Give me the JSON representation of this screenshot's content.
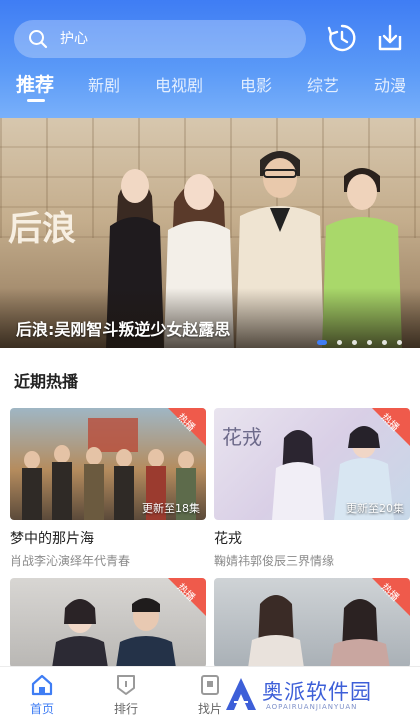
{
  "header": {
    "search_placeholder": "护心",
    "colors": {
      "accent": "#3f7df4",
      "header_top": "#3f7df4",
      "header_bottom": "#79b0fa"
    }
  },
  "tabs": [
    {
      "label": "推荐",
      "active": true
    },
    {
      "label": "新剧",
      "active": false
    },
    {
      "label": "电视剧",
      "active": false
    },
    {
      "label": "电影",
      "active": false
    },
    {
      "label": "综艺",
      "active": false
    },
    {
      "label": "动漫",
      "active": false
    }
  ],
  "banner": {
    "logo_text": "后浪",
    "caption": "后浪:吴刚智斗叛逆少女赵露思",
    "slides": 6,
    "active_slide": 1
  },
  "section": {
    "title": "近期热播"
  },
  "cards": [
    {
      "title": "梦中的那片海",
      "subtitle": "肖战李沁演绎年代青春",
      "badge": "热播",
      "update": "更新至18集"
    },
    {
      "title": "花戎",
      "subtitle": "鞠婧祎郭俊辰三界情缘",
      "badge": "热播",
      "update": "更新至20集"
    },
    {
      "title": "",
      "subtitle": "",
      "badge": "热播",
      "update": ""
    },
    {
      "title": "",
      "subtitle": "",
      "badge": "热播",
      "update": ""
    }
  ],
  "bottom_nav": [
    {
      "label": "首页",
      "icon": "home-icon",
      "active": true
    },
    {
      "label": "排行",
      "icon": "ranking-icon",
      "active": false
    },
    {
      "label": "找片",
      "icon": "find-icon",
      "active": false
    }
  ],
  "watermark": {
    "text": "奥派软件园",
    "sub": "AOPAIRUANJIANYUAN"
  }
}
